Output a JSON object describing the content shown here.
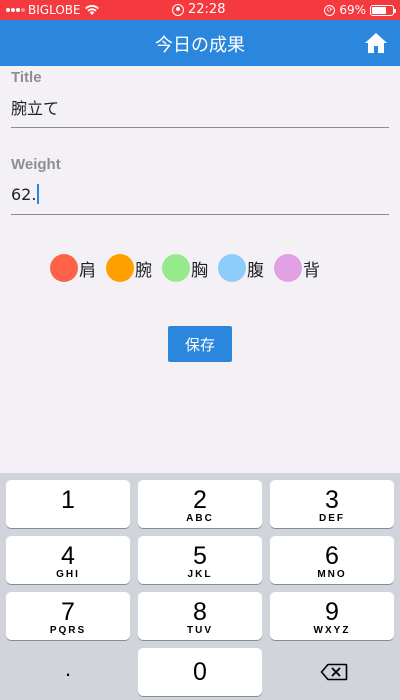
{
  "status_bar": {
    "carrier": "BIGLOBE",
    "time": "22:28",
    "battery_text": "69%",
    "battery_level": 0.69
  },
  "app_bar": {
    "title": "今日の成果",
    "home_icon": "home-icon"
  },
  "form": {
    "title_label": "Title",
    "title_value": "腕立て",
    "weight_label": "Weight",
    "weight_value": "62."
  },
  "parts": [
    {
      "label": "肩",
      "color": "#ff6347"
    },
    {
      "label": "腕",
      "color": "#ffa000"
    },
    {
      "label": "胸",
      "color": "#98e98d"
    },
    {
      "label": "腹",
      "color": "#8ecdf9"
    },
    {
      "label": "背",
      "color": "#e0a0e3"
    }
  ],
  "save_label": "保存",
  "keyboard": {
    "keys": [
      {
        "num": "1",
        "letters": ""
      },
      {
        "num": "2",
        "letters": "ABC"
      },
      {
        "num": "3",
        "letters": "DEF"
      },
      {
        "num": "4",
        "letters": "GHI"
      },
      {
        "num": "5",
        "letters": "JKL"
      },
      {
        "num": "6",
        "letters": "MNO"
      },
      {
        "num": "7",
        "letters": "PQRS"
      },
      {
        "num": "8",
        "letters": "TUV"
      },
      {
        "num": "9",
        "letters": "WXYZ"
      },
      {
        "num": ".",
        "letters": ""
      },
      {
        "num": "0",
        "letters": ""
      }
    ],
    "backspace_icon": "backspace-icon"
  }
}
